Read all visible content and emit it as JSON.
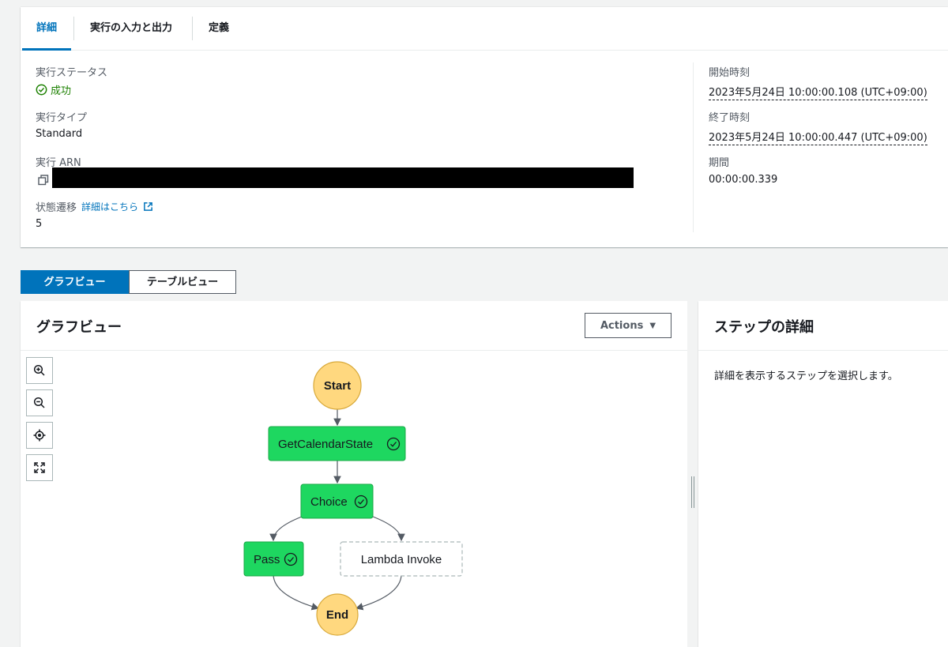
{
  "tabs": [
    {
      "label": "詳細",
      "active": true
    },
    {
      "label": "実行の入力と出力",
      "active": false
    },
    {
      "label": "定義",
      "active": false
    }
  ],
  "details": {
    "status_label": "実行ステータス",
    "status_value": "成功",
    "type_label": "実行タイプ",
    "type_value": "Standard",
    "arn_label": "実行 ARN",
    "transitions_label": "状態遷移",
    "transitions_link": "詳細はこちら",
    "transitions_value": "5",
    "start_label": "開始時刻",
    "start_value": "2023年5月24日 10:00:00.108 (UTC+09:00)",
    "end_label": "終了時刻",
    "end_value": "2023年5月24日 10:00:00.447 (UTC+09:00)",
    "duration_label": "期間",
    "duration_value": "00:00:00.339"
  },
  "view_toggle": {
    "graph": "グラフビュー",
    "table": "テーブルビュー",
    "selected": "graph"
  },
  "graph": {
    "title": "グラフビュー",
    "actions_label": "Actions",
    "nodes": [
      {
        "label": "Start",
        "kind": "terminal"
      },
      {
        "label": "GetCalendarState",
        "kind": "task",
        "status": "succeeded"
      },
      {
        "label": "Choice",
        "kind": "choice",
        "status": "succeeded"
      },
      {
        "label": "Pass",
        "kind": "pass",
        "status": "succeeded"
      },
      {
        "label": "Lambda Invoke",
        "kind": "task",
        "status": "not-run"
      },
      {
        "label": "End",
        "kind": "terminal"
      }
    ],
    "controls": [
      "zoom-in-icon",
      "zoom-out-icon",
      "center-icon",
      "fit-screen-icon"
    ]
  },
  "step_details": {
    "title": "ステップの詳細",
    "message": "詳細を表示するステップを選択します。"
  },
  "colors": {
    "accent": "#0073bb",
    "success": "#1d8102",
    "node_success": "#1ed760",
    "terminal": "#ffd87f"
  }
}
